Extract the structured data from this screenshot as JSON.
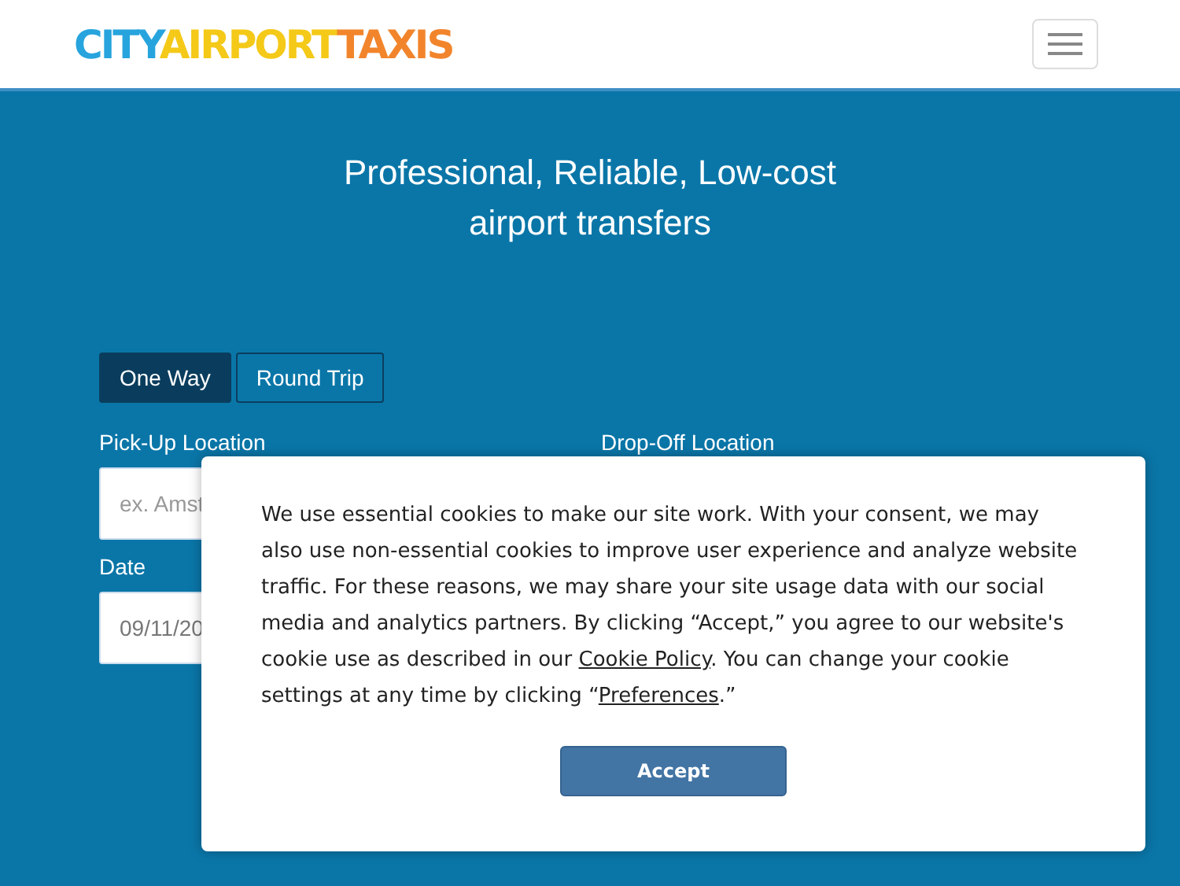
{
  "logo": [
    {
      "text": "CITY",
      "color": "#27a4dd"
    },
    {
      "text": "AIRPORT",
      "color": "#f4c918"
    },
    {
      "text": "TAXIS",
      "color": "#f2852c"
    }
  ],
  "headline": "Professional, Reliable, Low-cost airport transfers",
  "tabs": [
    {
      "label": "One Way",
      "selected": true
    },
    {
      "label": "Round Trip",
      "selected": false
    }
  ],
  "fields": [
    {
      "label": "Pick-Up Location",
      "placeholder": "ex. Amst"
    },
    {
      "label": "Drop-Off Location"
    },
    {
      "label": "Date",
      "value": "09/11/20"
    }
  ],
  "cookie_text": [
    {
      "kind": "text",
      "text": "We use essential cookies to make our site work. With your consent, we may also use non-essential cookies to improve user experience and analyze website traffic. For these reasons, we may share your site usage data with our social media and analytics partners. By clicking “Accept,” you agree to our website's cookie use as described in our "
    },
    {
      "kind": "link",
      "text": "Cookie Policy"
    },
    {
      "kind": "text",
      "text": ". You can change your cookie settings at any time by clicking “"
    },
    {
      "kind": "link",
      "text": "Preferences"
    },
    {
      "kind": "text",
      "text": ".”"
    }
  ],
  "accept_button": "Accept"
}
